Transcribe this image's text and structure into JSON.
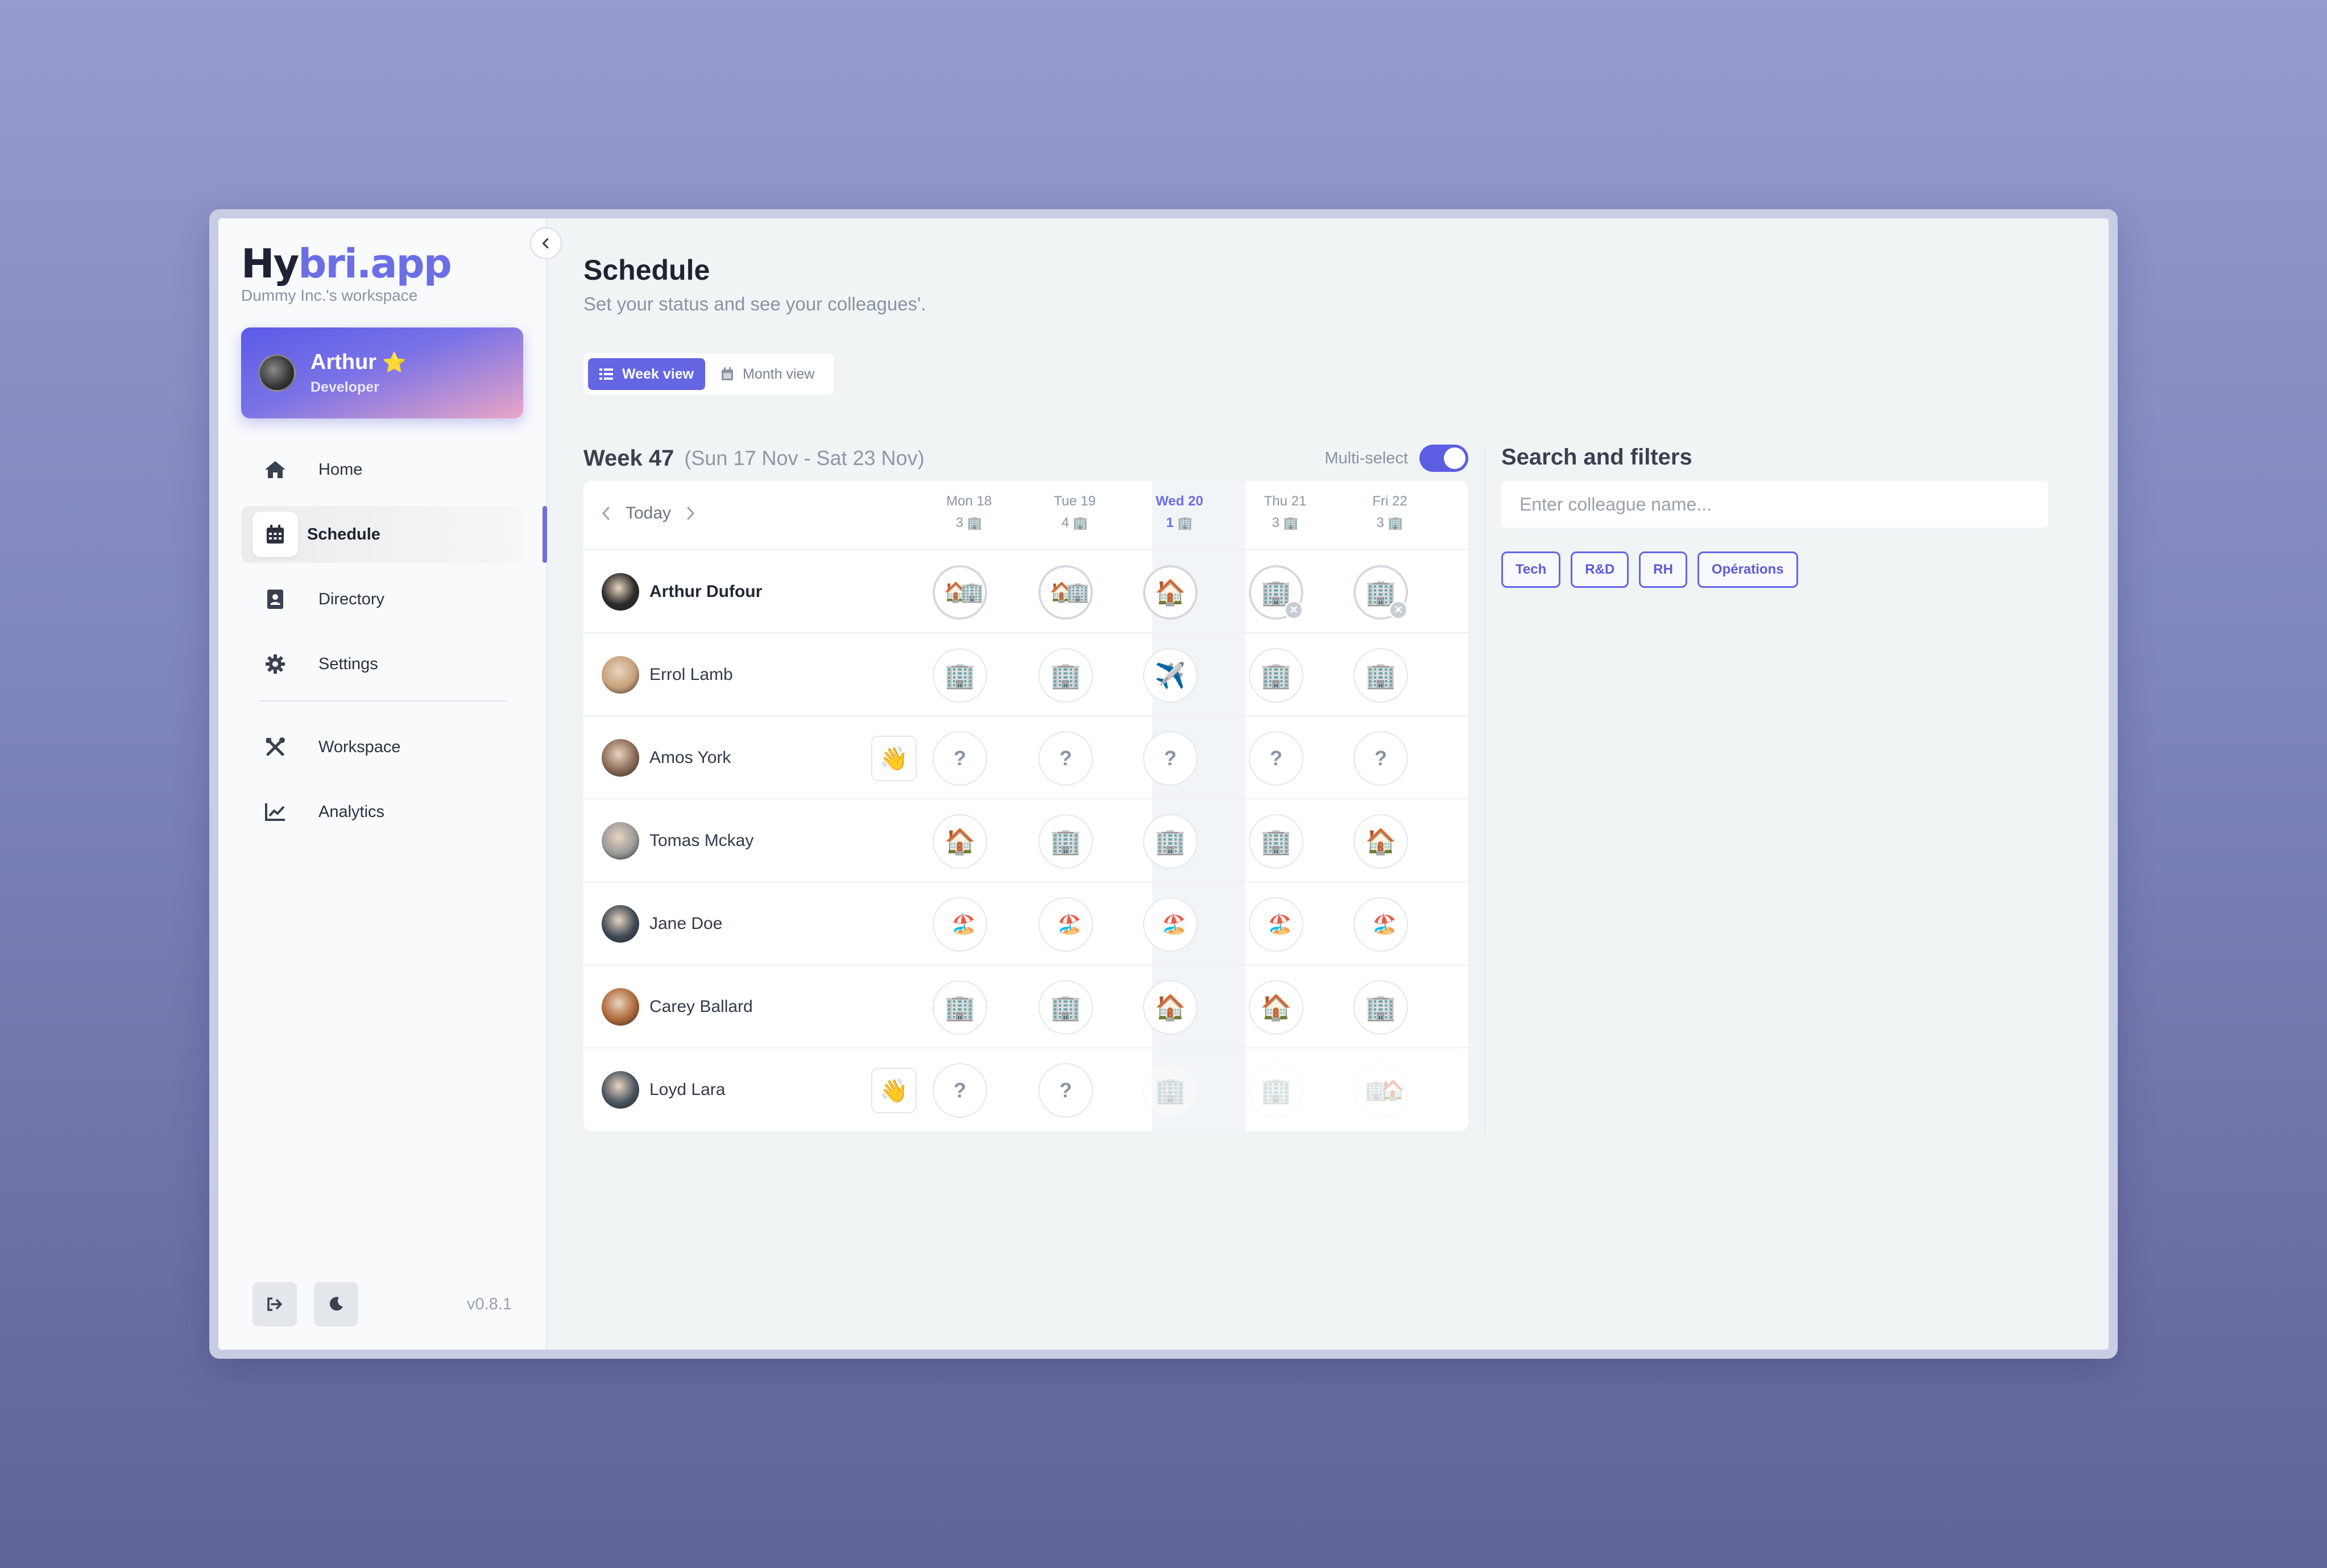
{
  "app": {
    "logo_prefix": "Hy",
    "logo_accent": "bri.app",
    "workspace": "Dummy Inc.'s workspace",
    "version": "v0.8.1",
    "accent_color": "#6466e2"
  },
  "user": {
    "name": "Arthur",
    "badge": "⭐",
    "role": "Developer"
  },
  "nav": {
    "home": "Home",
    "schedule": "Schedule",
    "directory": "Directory",
    "settings": "Settings",
    "workspace": "Workspace",
    "analytics": "Analytics"
  },
  "page": {
    "title": "Schedule",
    "subtitle": "Set your status and see your colleagues'.",
    "week_view": "Week view",
    "month_view": "Month view"
  },
  "week": {
    "title": "Week 47",
    "range": "(Sun 17 Nov - Sat 23 Nov)",
    "multi_select_label": "Multi-select",
    "multi_select_on": true,
    "today_label": "Today"
  },
  "days": [
    {
      "label": "Mon 18",
      "count": "3",
      "icon": "🏢",
      "today": false
    },
    {
      "label": "Tue 19",
      "count": "4",
      "icon": "🏢",
      "today": false
    },
    {
      "label": "Wed 20",
      "count": "1",
      "icon": "🏢",
      "today": true
    },
    {
      "label": "Thu 21",
      "count": "3",
      "icon": "🏢",
      "today": false
    },
    {
      "label": "Fri 22",
      "count": "3",
      "icon": "🏢",
      "today": false
    }
  ],
  "people": [
    {
      "name": "Arthur Dufour",
      "me": true,
      "wave": "",
      "avatar": "#2a2a2a",
      "status": [
        {
          "icon": "🏠🏢",
          "ring": true,
          "x": false,
          "faded": false
        },
        {
          "icon": "🏠🏢",
          "ring": true,
          "x": false,
          "faded": false
        },
        {
          "icon": "🏠",
          "ring": true,
          "x": false,
          "faded": false
        },
        {
          "icon": "🏢",
          "ring": true,
          "x": true,
          "faded": false
        },
        {
          "icon": "🏢",
          "ring": true,
          "x": true,
          "faded": false
        }
      ]
    },
    {
      "name": "Errol Lamb",
      "me": false,
      "wave": "",
      "avatar": "#c7a07a",
      "status": [
        {
          "icon": "🏢"
        },
        {
          "icon": "🏢"
        },
        {
          "icon": "✈️"
        },
        {
          "icon": "🏢"
        },
        {
          "icon": "🏢"
        }
      ]
    },
    {
      "name": "Amos York",
      "me": false,
      "wave": "👋",
      "avatar": "#8a6a55",
      "status": [
        {
          "icon": "?"
        },
        {
          "icon": "?"
        },
        {
          "icon": "?"
        },
        {
          "icon": "?"
        },
        {
          "icon": "?"
        }
      ]
    },
    {
      "name": "Tomas Mckay",
      "me": false,
      "wave": "",
      "avatar": "#9a9a9a",
      "status": [
        {
          "icon": "🏠"
        },
        {
          "icon": "🏢"
        },
        {
          "icon": "🏢"
        },
        {
          "icon": "🏢"
        },
        {
          "icon": "🏠"
        }
      ]
    },
    {
      "name": "Jane Doe",
      "me": false,
      "wave": "",
      "avatar": "#3f4a55",
      "status": [
        {
          "icon": "🏖️"
        },
        {
          "icon": "🏖️"
        },
        {
          "icon": "🏖️"
        },
        {
          "icon": "🏖️"
        },
        {
          "icon": "🏖️"
        }
      ]
    },
    {
      "name": "Carey Ballard",
      "me": false,
      "wave": "",
      "avatar": "#b0693a",
      "status": [
        {
          "icon": "🏢"
        },
        {
          "icon": "🏢"
        },
        {
          "icon": "🏠"
        },
        {
          "icon": "🏠"
        },
        {
          "icon": "🏢"
        }
      ]
    },
    {
      "name": "Loyd Lara",
      "me": false,
      "wave": "👋",
      "avatar": "#4a5560",
      "status": [
        {
          "icon": "?"
        },
        {
          "icon": "?"
        },
        {
          "icon": "🏢",
          "faded": true
        },
        {
          "icon": "🏢",
          "faded": true
        },
        {
          "icon": "🏢🏠",
          "faded": true
        }
      ]
    }
  ],
  "filters": {
    "title": "Search and filters",
    "search_placeholder": "Enter colleague name...",
    "tags": [
      "Tech",
      "R&D",
      "RH",
      "Opérations"
    ]
  }
}
